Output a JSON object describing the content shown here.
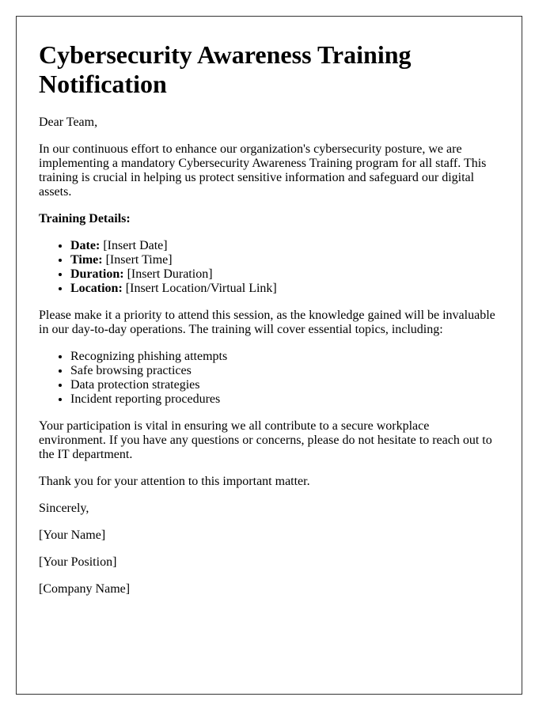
{
  "title": "Cybersecurity Awareness Training Notification",
  "greeting": "Dear Team,",
  "intro": "In our continuous effort to enhance our organization's cybersecurity posture, we are implementing a mandatory Cybersecurity Awareness Training program for all staff. This training is crucial in helping us protect sensitive information and safeguard our digital assets.",
  "details_heading": "Training Details:",
  "details": [
    {
      "label": "Date:",
      "value": "[Insert Date]"
    },
    {
      "label": "Time:",
      "value": "[Insert Time]"
    },
    {
      "label": "Duration:",
      "value": "[Insert Duration]"
    },
    {
      "label": "Location:",
      "value": "[Insert Location/Virtual Link]"
    }
  ],
  "priority_text": "Please make it a priority to attend this session, as the knowledge gained will be invaluable in our day-to-day operations. The training will cover essential topics, including:",
  "topics": [
    "Recognizing phishing attempts",
    "Safe browsing practices",
    "Data protection strategies",
    "Incident reporting procedures"
  ],
  "participation_text": "Your participation is vital in ensuring we all contribute to a secure workplace environment. If you have any questions or concerns, please do not hesitate to reach out to the IT department.",
  "thanks": "Thank you for your attention to this important matter.",
  "closing": "Sincerely,",
  "signature": {
    "name": "[Your Name]",
    "position": "[Your Position]",
    "company": "[Company Name]"
  }
}
